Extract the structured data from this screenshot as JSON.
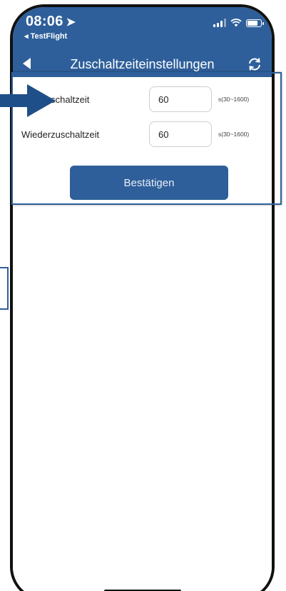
{
  "status_bar": {
    "time": "08:06",
    "back_app": "◂ TestFlight"
  },
  "navbar": {
    "title": "Zuschaltzeiteinstellungen"
  },
  "form": {
    "rows": [
      {
        "label": "Startzuschaltzeit",
        "value": "60",
        "hint": "s(30~1600)"
      },
      {
        "label": "Wiederzuschaltzeit",
        "value": "60",
        "hint": "s(30~1600)"
      }
    ],
    "confirm_label": "Bestätigen"
  },
  "colors": {
    "brand": "#2e5f9a",
    "annotation": "#1f4f88"
  },
  "icons": [
    "location-arrow-icon",
    "signal-icon",
    "wifi-icon",
    "battery-icon",
    "back-arrow-icon",
    "refresh-icon"
  ]
}
